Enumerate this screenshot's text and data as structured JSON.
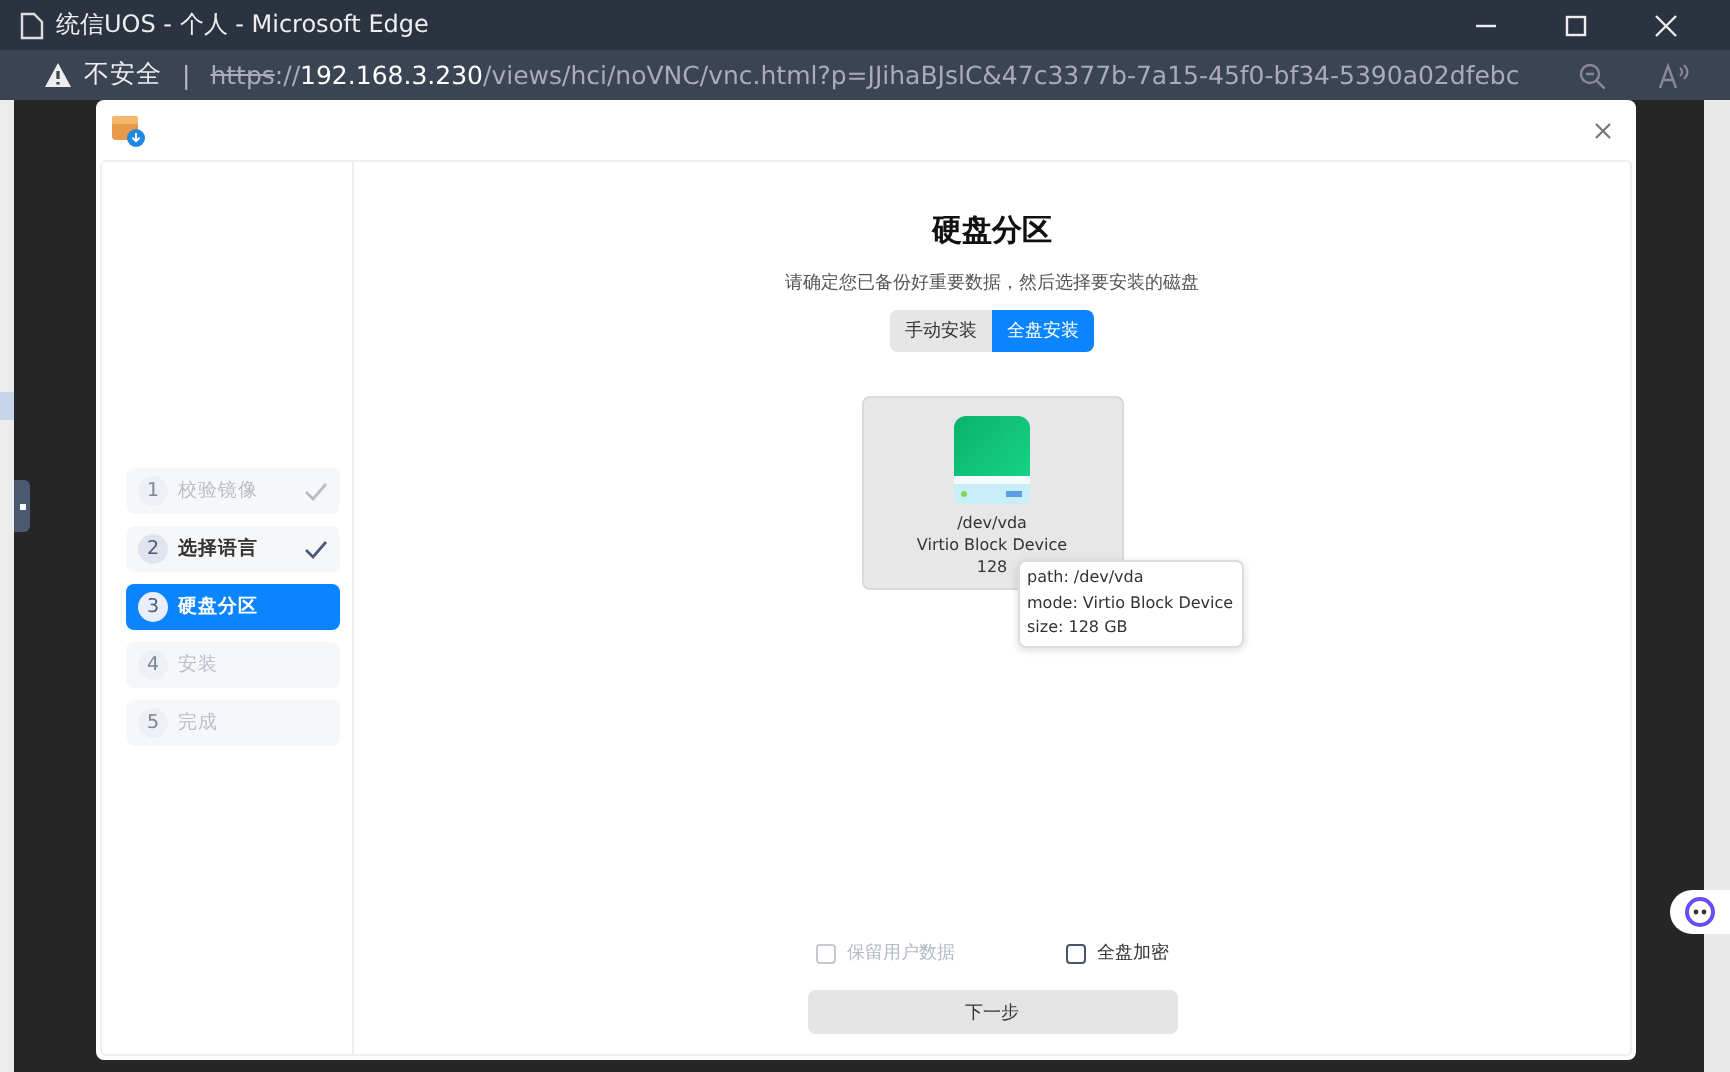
{
  "window": {
    "title": "统信UOS - 个人 - Microsoft Edge"
  },
  "address_bar": {
    "security": "不安全",
    "separator": "|",
    "url": {
      "scheme": "https",
      "rest": "://",
      "host": "192.168.3.230",
      "path": "/views/hci/noVNC/vnc.html?p=JJihaBJslC&47c3377b-7a15-45f0-bf34-5390a02dfebc"
    }
  },
  "installer": {
    "steps": [
      {
        "number": "1",
        "label": "校验镜像",
        "checked": true,
        "selected": false,
        "disabled": true
      },
      {
        "number": "2",
        "label": "选择语言",
        "checked": true,
        "selected": false,
        "disabled": false
      },
      {
        "number": "3",
        "label": "硬盘分区",
        "checked": false,
        "selected": true,
        "disabled": false
      },
      {
        "number": "4",
        "label": "安装",
        "checked": false,
        "selected": false,
        "disabled": true
      },
      {
        "number": "5",
        "label": "完成",
        "checked": false,
        "selected": false,
        "disabled": true
      }
    ],
    "title": "硬盘分区",
    "subtitle": "请确定您已备份好重要数据，然后选择要安装的磁盘",
    "modes": [
      {
        "label": "手动安装",
        "selected": false
      },
      {
        "label": "全盘安装",
        "selected": true
      }
    ],
    "disk": {
      "path": "/dev/vda",
      "model": "Virtio Block Device",
      "size": "128"
    },
    "tooltip": [
      "path: /dev/vda",
      "mode: Virtio Block Device",
      "size: 128 GB"
    ],
    "options": [
      {
        "label": "保留用户数据",
        "checked": false,
        "disabled": true
      },
      {
        "label": "全盘加密",
        "checked": false,
        "disabled": false
      }
    ],
    "next_button": "下一步"
  }
}
